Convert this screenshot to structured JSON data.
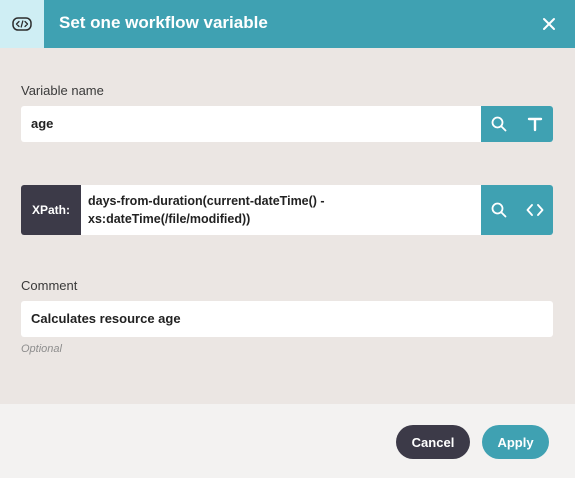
{
  "dialog": {
    "title": "Set one workflow variable"
  },
  "variable_name": {
    "label": "Variable name",
    "value": "age"
  },
  "xpath": {
    "tag": "XPath:",
    "line1": "days-from-duration(current-dateTime() -",
    "line2": "xs:dateTime(/file/modified))"
  },
  "comment": {
    "label": "Comment",
    "value": "Calculates resource age",
    "hint": "Optional"
  },
  "footer": {
    "cancel_label": "Cancel",
    "apply_label": "Apply"
  },
  "icons": {
    "header": "code-badge-icon",
    "close": "close-icon",
    "search": "search-icon",
    "text": "text-type-icon",
    "code": "code-brackets-icon"
  },
  "colors": {
    "accent": "#3fa1b2",
    "dark": "#3c3a48",
    "background": "#ebe6e3"
  }
}
